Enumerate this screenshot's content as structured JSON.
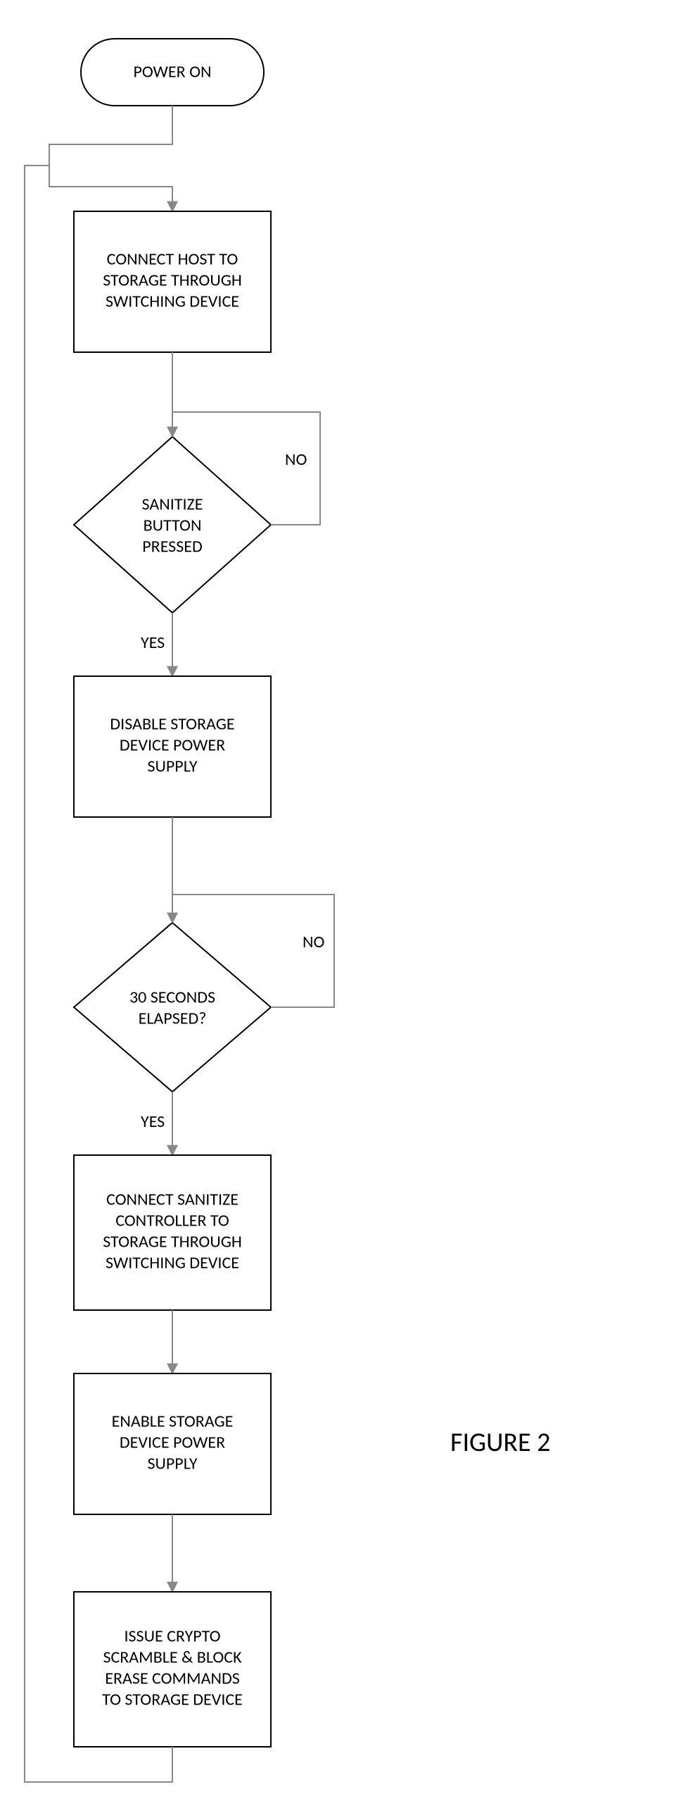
{
  "chart_data": {
    "type": "flowchart",
    "title": "FIGURE 2",
    "nodes": [
      {
        "id": "start",
        "type": "terminator",
        "text": "POWER ON"
      },
      {
        "id": "p1",
        "type": "process",
        "text": "CONNECT HOST TO STORAGE THROUGH SWITCHING DEVICE"
      },
      {
        "id": "d1",
        "type": "decision",
        "text": "SANITIZE BUTTON PRESSED"
      },
      {
        "id": "p2",
        "type": "process",
        "text": "DISABLE STORAGE DEVICE POWER SUPPLY"
      },
      {
        "id": "d2",
        "type": "decision",
        "text": "30 SECONDS ELAPSED?"
      },
      {
        "id": "p3",
        "type": "process",
        "text": "CONNECT SANITIZE CONTROLLER TO STORAGE THROUGH SWITCHING DEVICE"
      },
      {
        "id": "p4",
        "type": "process",
        "text": "ENABLE STORAGE DEVICE POWER SUPPLY"
      },
      {
        "id": "p5",
        "type": "process",
        "text": "ISSUE CRYPTO SCRAMBLE & BLOCK ERASE COMMANDS TO STORAGE DEVICE"
      }
    ],
    "edges": [
      {
        "from": "start",
        "to": "p1",
        "label": ""
      },
      {
        "from": "p1",
        "to": "d1",
        "label": ""
      },
      {
        "from": "d1",
        "to": "p2",
        "label": "YES"
      },
      {
        "from": "d1",
        "to": "d1",
        "label": "NO"
      },
      {
        "from": "p2",
        "to": "d2",
        "label": ""
      },
      {
        "from": "d2",
        "to": "p3",
        "label": "YES"
      },
      {
        "from": "d2",
        "to": "d2",
        "label": "NO"
      },
      {
        "from": "p3",
        "to": "p4",
        "label": ""
      },
      {
        "from": "p4",
        "to": "p5",
        "label": ""
      },
      {
        "from": "p5",
        "to": "p1",
        "label": ""
      }
    ]
  },
  "labels": {
    "yes": "YES",
    "no": "NO",
    "figure": "FIGURE 2"
  },
  "nodes": {
    "start": {
      "l1": "POWER ON"
    },
    "p1": {
      "l1": "CONNECT HOST TO",
      "l2": "STORAGE THROUGH",
      "l3": "SWITCHING DEVICE"
    },
    "d1": {
      "l1": "SANITIZE",
      "l2": "BUTTON",
      "l3": "PRESSED"
    },
    "p2": {
      "l1": "DISABLE STORAGE",
      "l2": "DEVICE POWER",
      "l3": "SUPPLY"
    },
    "d2": {
      "l1": "30 SECONDS",
      "l2": "ELAPSED?"
    },
    "p3": {
      "l1": "CONNECT SANITIZE",
      "l2": "CONTROLLER TO",
      "l3": "STORAGE THROUGH",
      "l4": "SWITCHING DEVICE"
    },
    "p4": {
      "l1": "ENABLE STORAGE",
      "l2": "DEVICE POWER",
      "l3": "SUPPLY"
    },
    "p5": {
      "l1": "ISSUE CRYPTO",
      "l2": "SCRAMBLE & BLOCK",
      "l3": "ERASE COMMANDS",
      "l4": "TO STORAGE DEVICE"
    }
  }
}
